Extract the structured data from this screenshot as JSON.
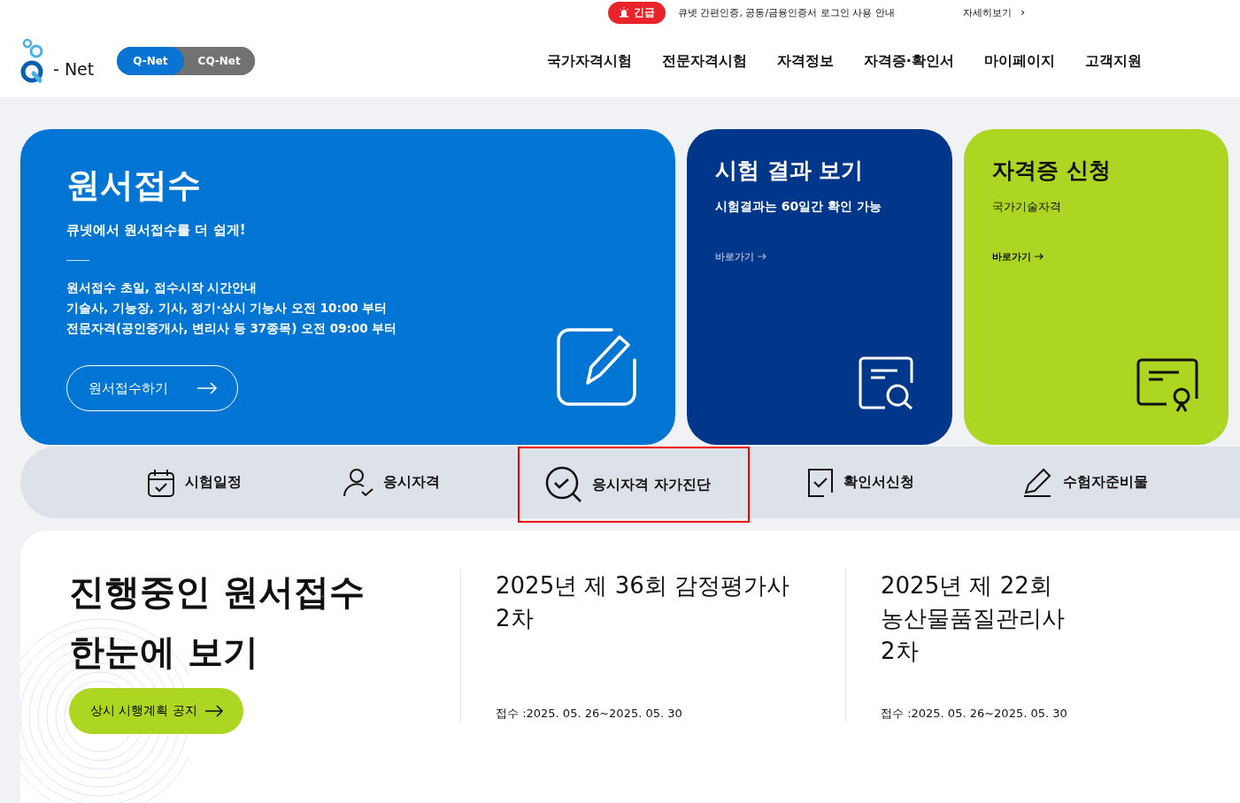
{
  "notice": {
    "badge": "긴급",
    "text": "큐넷 간편인증, 공동/금융인증서 로그인 사용 안내",
    "more": "자세히보기",
    "more_arrow": "›"
  },
  "logo": {
    "text": "- Net"
  },
  "site_switch": [
    {
      "label": "Q-Net",
      "selected": true
    },
    {
      "label": "CQ-Net",
      "selected": false
    }
  ],
  "nav": [
    "국가자격시험",
    "전문자격시험",
    "자격정보",
    "자격증·확인서",
    "마이페이지",
    "고객지원"
  ],
  "cards": [
    {
      "kind": "apply",
      "title": "원서접수",
      "subtitle": "큐넷에서 원서접수를 더 쉽게!",
      "lines": [
        "원서접수 초일, 접수시작 시간안내",
        "기술사, 기능장, 기사, 정기·상시 기능사 오전 10:00 부터",
        "전문자격(공인중개사, 변리사 등 37종목) 오전 09:00 부터"
      ],
      "button": "원서접수하기"
    },
    {
      "kind": "result",
      "title": "시험 결과 보기",
      "subtitle": "시험결과는 60일간 확인 가능",
      "link": "바로가기"
    },
    {
      "kind": "certificate",
      "title": "자격증 신청",
      "subtitle": "국가기술자격",
      "link": "바로가기"
    }
  ],
  "quick_menu": [
    {
      "kind": "calendar",
      "label": "시험일정",
      "highlighted": false
    },
    {
      "kind": "person",
      "label": "응시자격",
      "highlighted": false
    },
    {
      "kind": "diagnosis",
      "label": "응시자격 자가진단",
      "highlighted": true
    },
    {
      "kind": "document",
      "label": "확인서신청",
      "highlighted": false
    },
    {
      "kind": "pencil",
      "label": "수험자준비물",
      "highlighted": false
    }
  ],
  "ongoing": {
    "title_lines": [
      "진행중인 원서접수",
      "한눈에 보기"
    ],
    "button": "상시 시행계획 공지",
    "exams": [
      {
        "title_lines": [
          "2025년 제 36회 감정평가사",
          "2차"
        ],
        "period": "접수 :2025. 05. 26~2025. 05. 30"
      },
      {
        "title_lines": [
          "2025년 제 22회",
          "농산물품질관리사",
          "2차"
        ],
        "period": "접수 :2025. 05. 26~2025. 05. 30"
      }
    ]
  }
}
